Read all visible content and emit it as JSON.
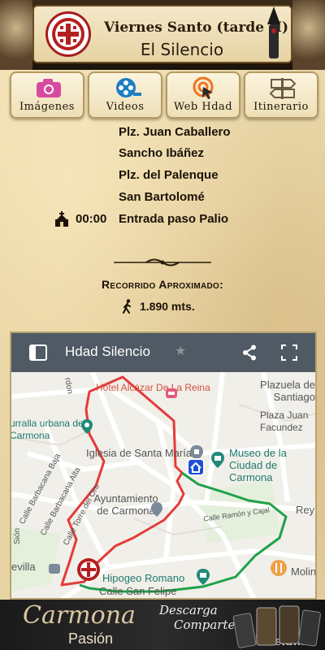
{
  "header": {
    "title": "Viernes Santo (tarde II)",
    "subtitle": "El Silencio"
  },
  "nav": [
    {
      "label": "Imágenes",
      "icon": "camera-icon"
    },
    {
      "label": "Videos",
      "icon": "film-reel-icon"
    },
    {
      "label": "Web Hdad",
      "icon": "web-cursor-icon"
    },
    {
      "label": "Itinerario",
      "icon": "signpost-icon"
    }
  ],
  "itinerary": {
    "streets": [
      "Plz. Juan Caballero",
      "Sancho Ibáñez",
      "Plz. del Palenque",
      "San Bartolomé"
    ],
    "event_time": "00:00",
    "event_label": "Entrada paso Palio"
  },
  "route": {
    "title": "Recorrido Aproximado:",
    "distance": "1.890 mts."
  },
  "map": {
    "title": "Hdad Silencio",
    "labels": [
      "Plazuela de Santiago",
      "Hotel Alcázar De La Reina",
      "Plaza Juan Facundez",
      "urralla urbana de Carmona",
      "Iglesia de Santa María",
      "Museo de la Ciudad de Carmona",
      "Calle Barbacana Baja",
      "Calle Barbacana Alta",
      "Calle Torre del Oro",
      "Ayuntamiento de Carmona",
      "Calle Ramón y Cajal",
      "Rey",
      "Hipogeo Romano",
      "Calle San Felipe",
      "evilla",
      "Molin",
      "rdon",
      "Sión"
    ]
  },
  "banner": {
    "brand": "Carmona",
    "brand_sub": "Pasión",
    "slogan1": "Descarga",
    "slogan2": "Comparte",
    "slogan3": "Vívela..!"
  }
}
